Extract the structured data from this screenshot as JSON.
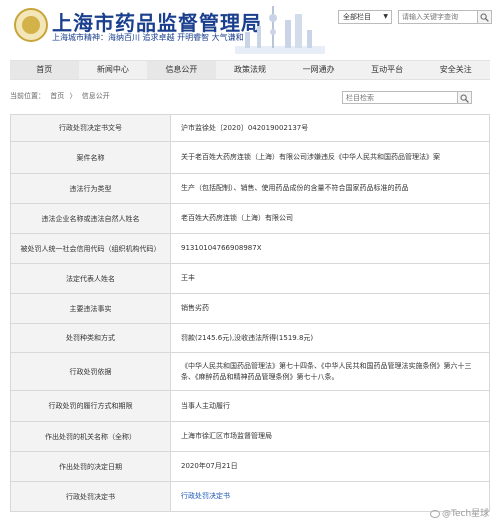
{
  "header": {
    "title": "上海市药品监督管理局",
    "motto": "上海城市精神：海纳百川 追求卓越 开明睿智 大气谦和",
    "scope_select": "全部栏目",
    "search_placeholder": "请输入关键字查询"
  },
  "nav": {
    "items": [
      {
        "label": "首页"
      },
      {
        "label": "新闻中心"
      },
      {
        "label": "信息公开"
      },
      {
        "label": "政策法规"
      },
      {
        "label": "一网通办"
      },
      {
        "label": "互动平台"
      },
      {
        "label": "安全关注"
      }
    ]
  },
  "breadcrumb": {
    "current_label": "当前位置：",
    "home": "首页",
    "sep": "〉",
    "section": "信息公开"
  },
  "site_search": {
    "placeholder": "栏目检索"
  },
  "table": {
    "rows": [
      {
        "label": "行政处罚决定书文号",
        "value": "沪市监徐处〔2020〕042019002137号"
      },
      {
        "label": "案件名称",
        "value": "关于老百姓大药房连锁（上海）有限公司涉嫌违反《中华人民共和国药品管理法》案"
      },
      {
        "label": "违法行为类型",
        "value": "生产（包括配制）、销售、使用药品成份的含量不符合国家药品标准的药品"
      },
      {
        "label": "违法企业名称或违法自然人姓名",
        "value": "老百姓大药房连锁（上海）有限公司"
      },
      {
        "label": "被处罚人统一社会信用代码（组织机构代码）",
        "value": "91310104766908987X"
      },
      {
        "label": "法定代表人姓名",
        "value": "王丰"
      },
      {
        "label": "主要违法事实",
        "value": "销售劣药"
      },
      {
        "label": "处罚种类和方式",
        "value": "罚款(2145.6元),没收违法所得(1519.8元)"
      },
      {
        "label": "行政处罚依据",
        "value": "《中华人民共和国药品管理法》第七十四条、《中华人民共和国药品管理法实施条例》第六十三条、《麻醉药品和精神药品管理条例》第七十八条。"
      },
      {
        "label": "行政处罚的履行方式和期限",
        "value": "当事人主动履行"
      },
      {
        "label": "作出处罚的机关名称（全称）",
        "value": "上海市徐汇区市场监督管理局"
      },
      {
        "label": "作出处罚的决定日期",
        "value": "2020年07月21日"
      },
      {
        "label": "行政处罚决定书",
        "value": "行政处罚决定书"
      }
    ]
  },
  "watermark": {
    "text": "@Tech星球"
  },
  "colors": {
    "brand_blue": "#1a3f8f",
    "link_blue": "#1a56b8",
    "label_bg": "#f3f3f3"
  }
}
